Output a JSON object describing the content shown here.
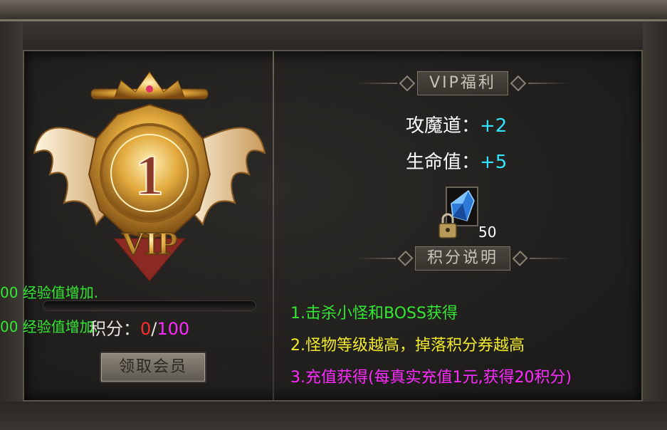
{
  "system_messages": [
    "00 经验值增加.",
    "00 经验值增加."
  ],
  "vip": {
    "badge_number": "1",
    "badge_text": "VIP",
    "exp_progress": 0,
    "points_label": "积分：",
    "points_current": "0",
    "points_separator": "/",
    "points_max": "100",
    "claim_button": "领取会员"
  },
  "benefits": {
    "title": "VIP福利",
    "stats": [
      {
        "label": "攻魔道：",
        "value": "+2"
      },
      {
        "label": "生命值：",
        "value": "+5"
      }
    ],
    "reward_item": {
      "icon": "blue-crystal-icon",
      "locked": true,
      "count": "50"
    }
  },
  "points_explain": {
    "title": "积分说明",
    "rules": [
      {
        "text": "1.击杀小怪和BOSS获得",
        "color": "#33e833"
      },
      {
        "text": "2.怪物等级越高，掉落积分券越高",
        "color": "#f2ea2a"
      },
      {
        "text": "3.充值获得(每真实充值1元,获得20积分)",
        "color": "#ff2aff"
      }
    ]
  },
  "colors": {
    "stat_value": "#33e4ff",
    "points_current": "#ff2a2a",
    "points_max": "#ff2aff",
    "system_text": "#33e833"
  }
}
